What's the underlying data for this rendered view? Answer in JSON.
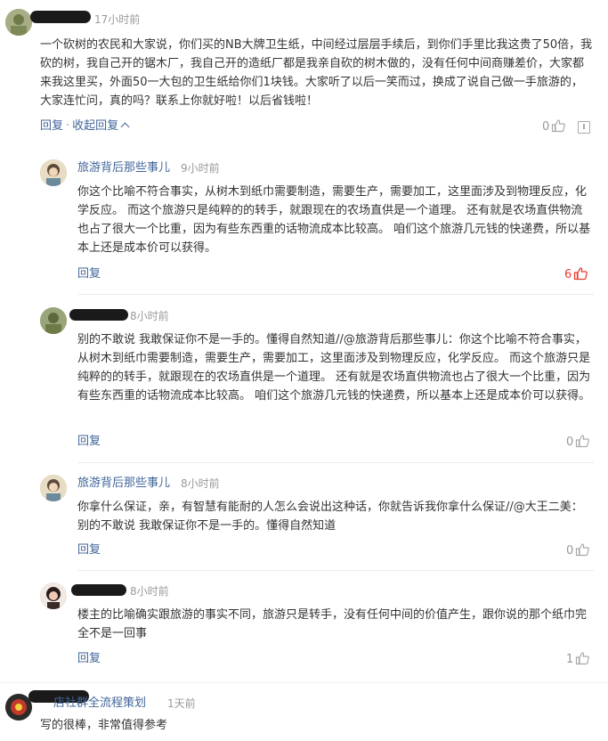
{
  "comments": [
    {
      "time": "17小时前",
      "body": "一个砍树的农民和大家说，你们买的NB大牌卫生纸，中间经过层层手续后，到你们手里比我这贵了50倍，我砍的树，我自己开的锯木厂，我自己开的造纸厂都是我亲自砍的树木做的，没有任何中间商赚差价，大家都来我这里买，外面50一大包的卫生纸给你们1块钱。大家听了以后一笑而过，换成了说自己做一手旅游的，大家连忙问，真的吗？联系上你就好啦！以后省钱啦！",
      "reply_label": "回复",
      "collapse_label": "收起回复",
      "like_count": "0"
    },
    {
      "author": "旅游背后那些事儿",
      "time": "9小时前",
      "body": "你这个比喻不符合事实，从树木到纸巾需要制造，需要生产，需要加工，这里面涉及到物理反应，化学反应。 而这个旅游只是纯粹的的转手，就跟现在的农场直供是一个道理。 还有就是农场直供物流也占了很大一个比重，因为有些东西重的话物流成本比较高。 咱们这个旅游几元钱的快递费，所以基本上还是成本价可以获得。",
      "reply_label": "回复",
      "like_count": "6"
    },
    {
      "time": "8小时前",
      "body": "别的不敢说 我敢保证你不是一手的。懂得自然知道//@旅游背后那些事儿：你这个比喻不符合事实，从树木到纸巾需要制造，需要生产，需要加工，这里面涉及到物理反应，化学反应。 而这个旅游只是纯粹的的转手，就跟现在的农场直供是一个道理。 还有就是农场直供物流也占了很大一个比重，因为有些东西重的话物流成本比较高。 咱们这个旅游几元钱的快递费，所以基本上还是成本价可以获得。",
      "reply_label": "回复",
      "like_count": "0"
    },
    {
      "author": "旅游背后那些事儿",
      "time": "8小时前",
      "body": "你拿什么保证，亲，有智慧有能耐的人怎么会说出这种话，你就告诉我你拿什么保证//@大王二美：别的不敢说 我敢保证你不是一手的。懂得自然知道",
      "reply_label": "回复",
      "like_count": "0"
    },
    {
      "time": "8小时前",
      "body": "楼主的比喻确实跟旅游的事实不同，旅游只是转手，没有任何中间的价值产生，跟你说的那个纸巾完全不是一回事",
      "reply_label": "回复",
      "like_count": "1"
    },
    {
      "author_suffix": "店社群全流程策划",
      "time": "1天前",
      "body": "写的很棒，非常值得参考"
    }
  ],
  "colors": {
    "link": "#406599",
    "muted": "#999999",
    "hot": "#e33e33",
    "text": "#333333"
  },
  "icons": [
    "thumbs-up-icon",
    "report-icon",
    "chevron-up-icon"
  ]
}
